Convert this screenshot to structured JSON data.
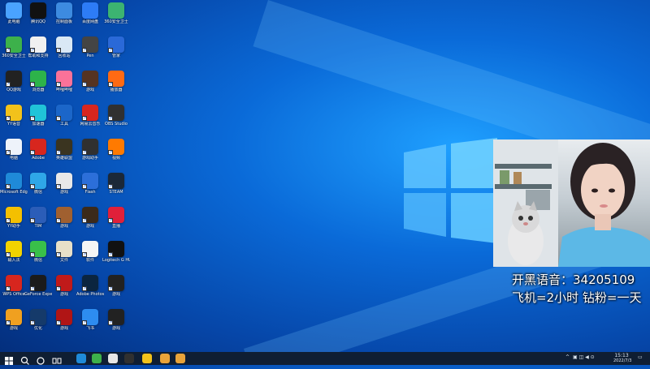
{
  "desktop_icons": [
    {
      "label": "此电脑",
      "color": "#4aa3ff"
    },
    {
      "label": "腾讯QQ",
      "color": "#111111"
    },
    {
      "label": "控制面板",
      "color": "#3d8be0"
    },
    {
      "label": "百度网盘",
      "color": "#2d7cf6"
    },
    {
      "label": "360安全卫士",
      "color": "#3cb371"
    },
    {
      "label": "360安全卫士",
      "color": "#3db14b"
    },
    {
      "label": "帮助和支持",
      "color": "#f0f0f0"
    },
    {
      "label": "回收站",
      "color": "#d9e8f5"
    },
    {
      "label": "Pen",
      "color": "#444444"
    },
    {
      "label": "管家",
      "color": "#2a69d8"
    },
    {
      "label": "QQ游戏",
      "color": "#222222"
    },
    {
      "label": "浏览器",
      "color": "#2db34a"
    },
    {
      "label": "哔哩哔哩",
      "color": "#fb7299"
    },
    {
      "label": "游戏",
      "color": "#553322"
    },
    {
      "label": "播放器",
      "color": "#ff6a13"
    },
    {
      "label": "YY语音",
      "color": "#f2c21b"
    },
    {
      "label": "加速器",
      "color": "#20c4d8"
    },
    {
      "label": "工具",
      "color": "#1b66c9"
    },
    {
      "label": "网易云音乐",
      "color": "#d7261e"
    },
    {
      "label": "OBS Studio",
      "color": "#303030"
    },
    {
      "label": "电脑",
      "color": "#eef3fa"
    },
    {
      "label": "Adobe",
      "color": "#d7261e"
    },
    {
      "label": "英雄联盟",
      "color": "#3a3420"
    },
    {
      "label": "游戏助手",
      "color": "#303030"
    },
    {
      "label": "视频",
      "color": "#ff7a00"
    },
    {
      "label": "Microsoft Edge",
      "color": "#1f8ad8"
    },
    {
      "label": "微信",
      "color": "#2fa7e8"
    },
    {
      "label": "游戏",
      "color": "#e8e8e8"
    },
    {
      "label": "Flash",
      "color": "#2c6fd9"
    },
    {
      "label": "STEAM",
      "color": "#1b2838"
    },
    {
      "label": "YY助手",
      "color": "#f4c000"
    },
    {
      "label": "TIM",
      "color": "#2b5db8"
    },
    {
      "label": "游戏",
      "color": "#a06030"
    },
    {
      "label": "游戏",
      "color": "#3b2a1a"
    },
    {
      "label": "直播",
      "color": "#e0203a"
    },
    {
      "label": "输入法",
      "color": "#f2d300"
    },
    {
      "label": "微信",
      "color": "#39c04a"
    },
    {
      "label": "文件",
      "color": "#e8e0c8"
    },
    {
      "label": "软件",
      "color": "#f5f5f5"
    },
    {
      "label": "Logitech G HUB",
      "color": "#111111"
    },
    {
      "label": "WPS Office",
      "color": "#d7261e"
    },
    {
      "label": "GeForce Experience",
      "color": "#1b1b1b"
    },
    {
      "label": "游戏",
      "color": "#c01a1a"
    },
    {
      "label": "Adobe Photoshop",
      "color": "#0b2540"
    },
    {
      "label": "游戏",
      "color": "#222222"
    },
    {
      "label": "游戏",
      "color": "#f0a020"
    },
    {
      "label": "优化",
      "color": "#153a6a"
    },
    {
      "label": "游戏",
      "color": "#b01515"
    },
    {
      "label": "飞书",
      "color": "#2d8cf0"
    },
    {
      "label": "游戏",
      "color": "#222222"
    }
  ],
  "webcam": {
    "description_label": "webcam"
  },
  "overlay": {
    "line1": "开黑语音：34205109",
    "line2": "飞机=2小时 钻粉=一天"
  },
  "taskbar": {
    "start_icon": "windows-icon",
    "search_icon": "search-icon",
    "taskview_icon": "task-view-icon",
    "time": "15:13",
    "date": "2022/7/3",
    "apps": [
      {
        "name": "edge-icon",
        "color": "#1f8ad8"
      },
      {
        "name": "360-icon",
        "color": "#3db14b"
      },
      {
        "name": "app-icon",
        "color": "#e6e6e6"
      },
      {
        "name": "obs-icon",
        "color": "#303030"
      },
      {
        "name": "yy-icon",
        "color": "#f2c21b"
      },
      {
        "name": "folder-icon",
        "color": "#e8a33a"
      },
      {
        "name": "folder-icon",
        "color": "#e8a33a"
      }
    ]
  }
}
